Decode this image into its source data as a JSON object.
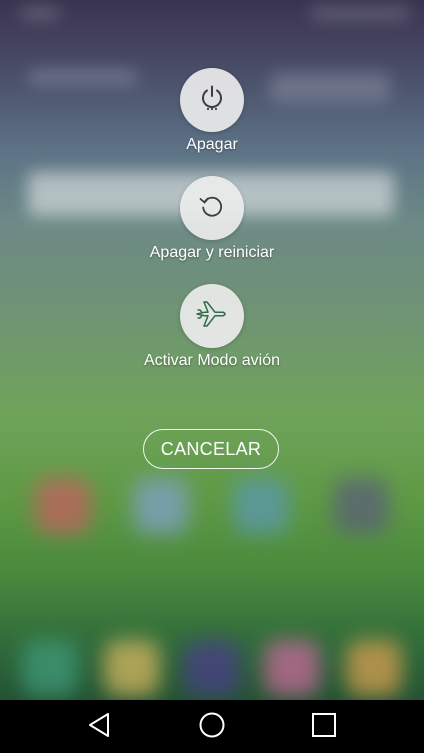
{
  "power_menu": {
    "items": [
      {
        "label": "Apagar",
        "icon": "power-icon"
      },
      {
        "label": "Apagar y reiniciar",
        "icon": "restart-icon"
      },
      {
        "label": "Activar Modo avión",
        "icon": "airplane-icon"
      }
    ],
    "cancel_label": "CANCELAR"
  },
  "nav_bar": {
    "buttons": [
      "back-icon",
      "home-icon",
      "recents-icon"
    ]
  },
  "colors": {
    "circle_bg": "#ececec",
    "icon_stroke": "#3d3d3d",
    "airplane_stroke": "#2e6b4a",
    "nav_bg": "#000000"
  }
}
